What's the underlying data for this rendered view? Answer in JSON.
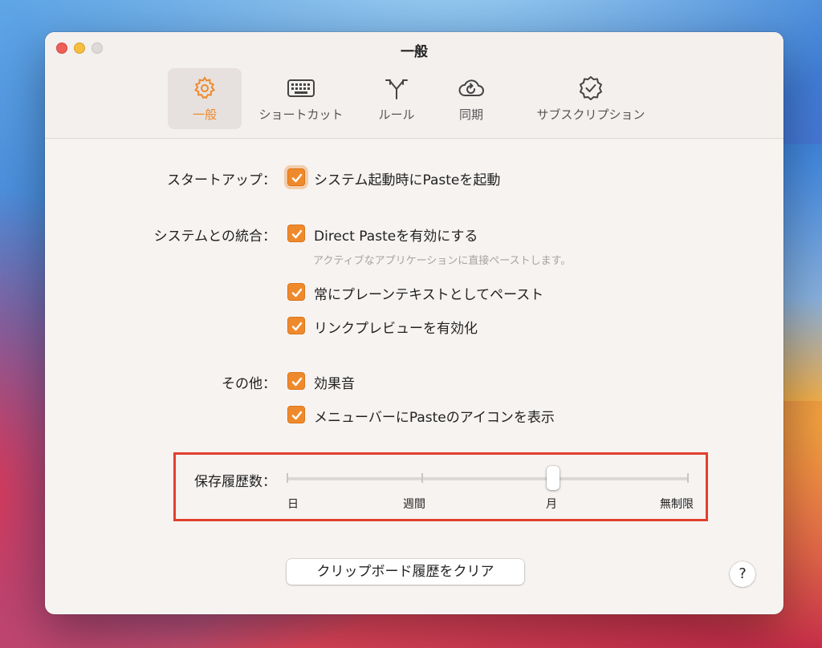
{
  "window": {
    "title": "一般"
  },
  "tabs": [
    {
      "label": "一般",
      "icon": "gear-icon",
      "active": true
    },
    {
      "label": "ショートカット",
      "icon": "keyboard-icon",
      "active": false
    },
    {
      "label": "ルール",
      "icon": "fork-icon",
      "active": false
    },
    {
      "label": "同期",
      "icon": "cloud-sync-icon",
      "active": false
    },
    {
      "label": "サブスクリプション",
      "icon": "badge-check-icon",
      "active": false
    }
  ],
  "startup": {
    "label": "スタートアップ：",
    "options": [
      {
        "label": "システム起動時にPasteを起動",
        "checked": true
      }
    ]
  },
  "integration": {
    "label": "システムとの統合：",
    "options": [
      {
        "label": "Direct Pasteを有効にする",
        "checked": true,
        "description": "アクティブなアプリケーションに直接ペーストします。"
      },
      {
        "label": "常にプレーンテキストとしてペースト",
        "checked": true
      },
      {
        "label": "リンクプレビューを有効化",
        "checked": true
      }
    ]
  },
  "other": {
    "label": "その他：",
    "options": [
      {
        "label": "効果音",
        "checked": true
      },
      {
        "label": "メニューバーにPasteのアイコンを表示",
        "checked": true
      }
    ]
  },
  "history": {
    "label": "保存履歴数：",
    "ticks": [
      "日",
      "週間",
      "月",
      "無制限"
    ],
    "selected_index": 2
  },
  "clear_button": {
    "label": "クリップボード履歴をクリア"
  },
  "help_button": {
    "label": "?"
  },
  "colors": {
    "accent": "#ef8a2c",
    "highlight": "#e2402c"
  }
}
